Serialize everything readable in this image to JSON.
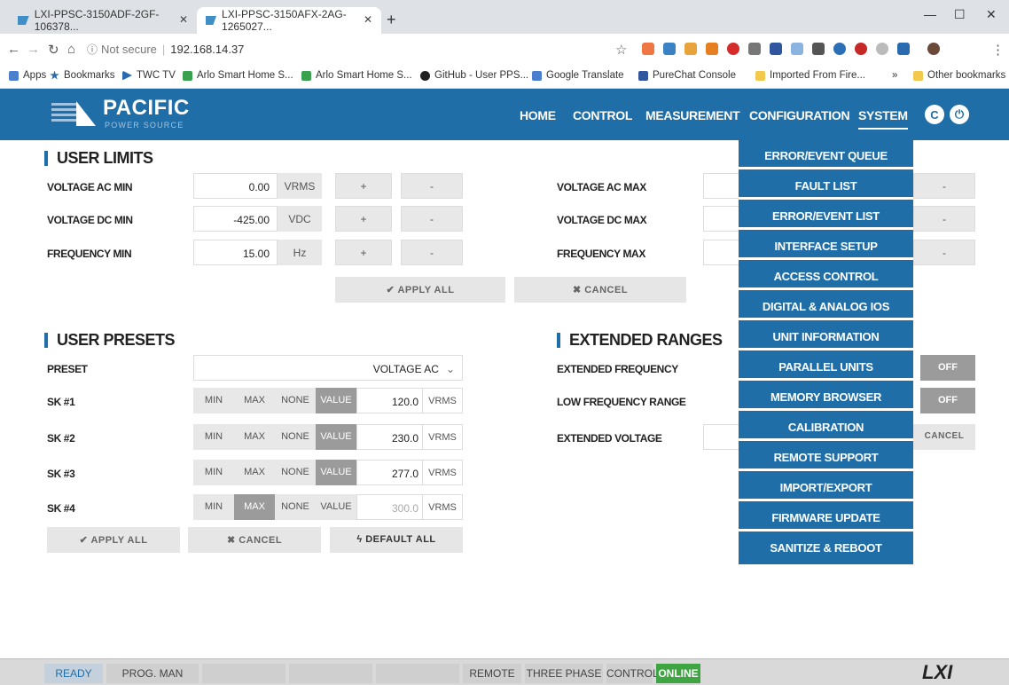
{
  "browser": {
    "tabs": [
      {
        "label": "LXI-PPSC-3150ADF-2GF-106378..."
      },
      {
        "label": "LXI-PPSC-3150AFX-2AG-1265027..."
      }
    ],
    "security": "Not secure",
    "url": "192.168.14.37",
    "bookmarks": [
      "Apps",
      "Bookmarks",
      "TWC TV",
      "Arlo Smart Home S...",
      "Arlo Smart Home S...",
      "GitHub - User PPS...",
      "Google Translate",
      "PureChat Console",
      "Imported From Fire...",
      "Other bookmarks"
    ],
    "overflow": "»"
  },
  "app": {
    "logo_name": "PACIFIC",
    "logo_sub": "POWER SOURCE",
    "nav": [
      "HOME",
      "CONTROL",
      "MEASUREMENT",
      "CONFIGURATION",
      "SYSTEM"
    ],
    "refresh_glyph": "C",
    "power_glyph": "⏻"
  },
  "user_limits": {
    "title": "USER LIMITS",
    "rows": [
      {
        "label": "VOLTAGE AC MIN",
        "value": "0.00",
        "unit": "VRMS",
        "max_label": "VOLTAGE AC MAX"
      },
      {
        "label": "VOLTAGE DC MIN",
        "value": "-425.00",
        "unit": "VDC",
        "max_label": "VOLTAGE DC MAX"
      },
      {
        "label": "FREQUENCY MIN",
        "value": "15.00",
        "unit": "Hz",
        "max_label": "FREQUENCY MAX"
      }
    ],
    "plus": "+",
    "minus": "-",
    "apply_all": "APPLY ALL",
    "cancel": "CANCEL"
  },
  "user_presets": {
    "title": "USER PRESETS",
    "preset_label": "PRESET",
    "preset_value": "VOLTAGE AC",
    "segments": [
      "MIN",
      "MAX",
      "NONE",
      "VALUE"
    ],
    "rows": [
      {
        "label": "SK #1",
        "selected": "VALUE",
        "value": "120.0",
        "unit": "VRMS"
      },
      {
        "label": "SK #2",
        "selected": "VALUE",
        "value": "230.0",
        "unit": "VRMS"
      },
      {
        "label": "SK #3",
        "selected": "VALUE",
        "value": "277.0",
        "unit": "VRMS"
      },
      {
        "label": "SK #4",
        "selected": "MAX",
        "value": "300.0",
        "unit": "VRMS"
      }
    ],
    "apply_all": "APPLY ALL",
    "cancel": "CANCEL",
    "default_all": "DEFAULT ALL"
  },
  "extended_ranges": {
    "title": "EXTENDED RANGES",
    "rows": [
      {
        "label": "EXTENDED FREQUENCY",
        "state": "OFF"
      },
      {
        "label": "LOW FREQUENCY RANGE",
        "state": "OFF"
      },
      {
        "label": "EXTENDED VOLTAGE"
      }
    ],
    "cancel": "CANCEL"
  },
  "system_menu": {
    "items": [
      "ERROR/EVENT QUEUE",
      "FAULT LIST",
      "ERROR/EVENT LIST",
      "INTERFACE SETUP",
      "ACCESS CONTROL",
      "DIGITAL & ANALOG IOS",
      "UNIT INFORMATION",
      "PARALLEL UNITS",
      "MEMORY BROWSER",
      "CALIBRATION",
      "REMOTE SUPPORT",
      "IMPORT/EXPORT",
      "FIRMWARE UPDATE",
      "SANITIZE & REBOOT"
    ]
  },
  "status_bar": {
    "ready": "READY",
    "prog": "PROG. MAN",
    "remote": "REMOTE",
    "phase": "THREE PHASE",
    "control": "CONTROL",
    "online": "ONLINE",
    "brand": "LXI"
  },
  "colors": {
    "brand": "#1f6ea8",
    "online": "#3fa543"
  }
}
